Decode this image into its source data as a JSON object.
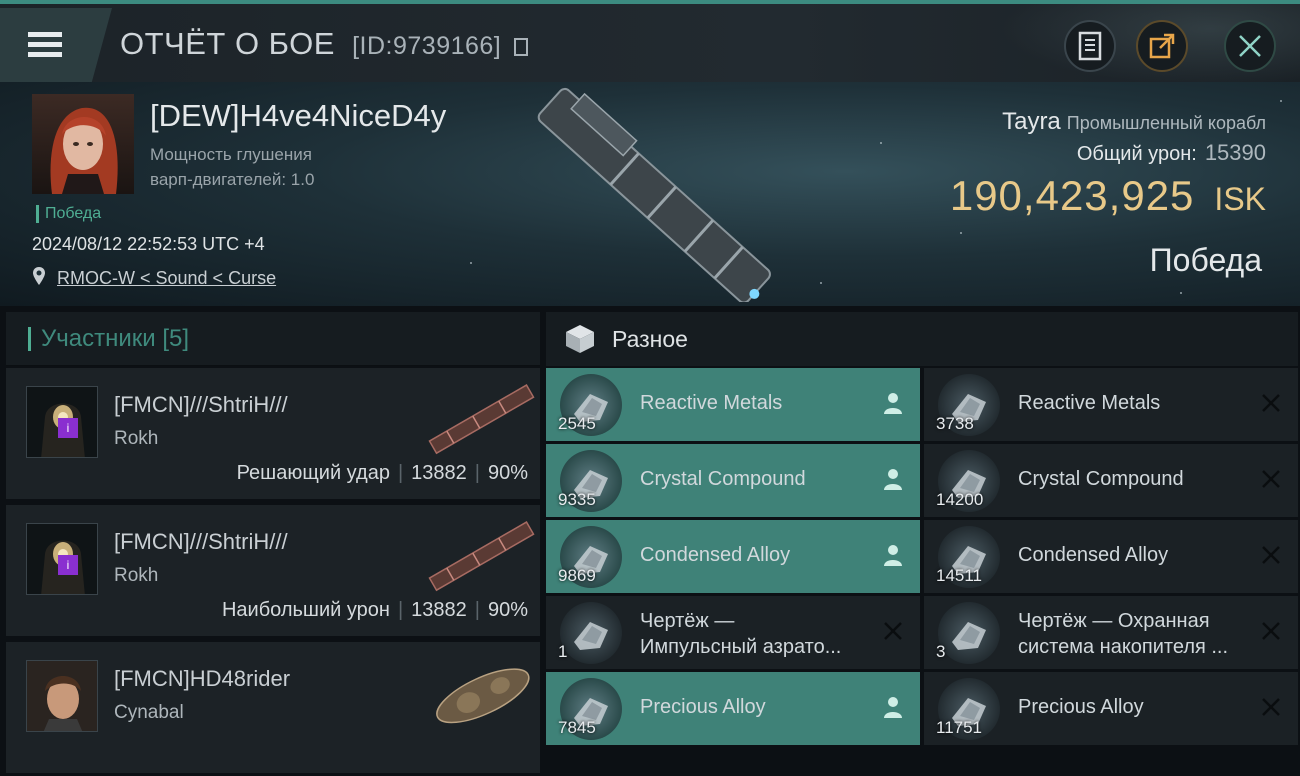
{
  "header": {
    "title": "ОТЧЁТ О БОЕ",
    "report_id": "[ID:9739166]"
  },
  "victim": {
    "name": "[DEW]H4ve4NiceD4y",
    "attribute_line1": "Мощность глушения",
    "attribute_line2": "варп-двигателей: 1.0",
    "status": "Победа",
    "timestamp": "2024/08/12 22:52:53 UTC +4",
    "location": "RMOC-W < Sound < Curse",
    "ship_name": "Tayra",
    "ship_class": "Промышленный корабл",
    "damage_label": "Общий урон:",
    "damage_value": "15390",
    "isk_value": "190,423,925",
    "isk_unit": "ISK",
    "result": "Победа"
  },
  "participants": {
    "heading": "Участники [5]",
    "rows": [
      {
        "name": "[FMCN]///ShtriH///",
        "ship": "Rokh",
        "role": "Решающий удар",
        "damage": "13882",
        "percent": "90%",
        "badge": "i"
      },
      {
        "name": "[FMCN]///ShtriH///",
        "ship": "Rokh",
        "role": "Наибольший урон",
        "damage": "13882",
        "percent": "90%",
        "badge": "i"
      },
      {
        "name": "[FMCN]HD48rider",
        "ship": "Cynabal"
      }
    ]
  },
  "loot": {
    "heading": "Разное",
    "items": [
      {
        "name": "Reactive Metals",
        "qty": "2545",
        "state": "dropped"
      },
      {
        "name": "Reactive Metals",
        "qty": "3738",
        "state": "destroyed"
      },
      {
        "name": "Crystal Compound",
        "qty": "9335",
        "state": "dropped"
      },
      {
        "name": "Crystal Compound",
        "qty": "14200",
        "state": "destroyed"
      },
      {
        "name": "Condensed Alloy",
        "qty": "9869",
        "state": "dropped"
      },
      {
        "name": "Condensed Alloy",
        "qty": "14511",
        "state": "destroyed"
      },
      {
        "name_line1": "Чертёж —",
        "name_line2": "Импульсный азрато...",
        "qty": "1",
        "state": "destroyed"
      },
      {
        "name_line1": "Чертёж — Охранная",
        "name_line2": "система накопителя ...",
        "qty": "3",
        "state": "destroyed"
      },
      {
        "name": "Precious Alloy",
        "qty": "7845",
        "state": "dropped"
      },
      {
        "name": "Precious Alloy",
        "qty": "11751",
        "state": "destroyed"
      }
    ]
  },
  "colors": {
    "accent": "#4fae93",
    "isk": "#e8c989",
    "dropped_bg": "#3f8278",
    "implant_badge": "#8a2fd0"
  }
}
